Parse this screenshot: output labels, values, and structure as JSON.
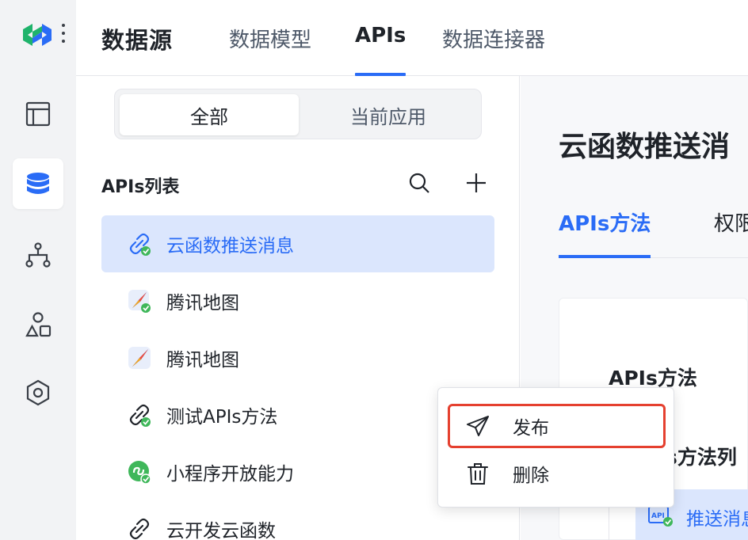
{
  "app": {
    "brand": "数据源",
    "tabs": [
      {
        "label": "数据模型"
      },
      {
        "label": "APIs"
      },
      {
        "label": "数据连接器"
      }
    ]
  },
  "rail": {
    "icons": [
      "layout-icon",
      "database-icon",
      "tree-structure-icon",
      "shapes-icon",
      "hexagon-settings-icon"
    ],
    "active": "database-icon"
  },
  "list": {
    "segments": [
      {
        "label": "全部"
      },
      {
        "label": "当前应用"
      }
    ],
    "title": "APIs列表",
    "items": [
      {
        "label": "云函数推送消息",
        "icon": "link-check-icon"
      },
      {
        "label": "腾讯地图",
        "icon": "compass-check-icon"
      },
      {
        "label": "腾讯地图",
        "icon": "compass-icon"
      },
      {
        "label": "测试APIs方法",
        "icon": "link-check-icon"
      },
      {
        "label": "小程序开放能力",
        "icon": "miniprogram-check-icon"
      },
      {
        "label": "云开发云函数",
        "icon": "link-icon"
      }
    ]
  },
  "detail": {
    "title": "云函数推送消",
    "tabs": [
      {
        "label": "APIs方法"
      },
      {
        "label": "权限"
      }
    ],
    "card_title": "APIs方法",
    "card_sub": "s方法列",
    "row_label": "推送消息"
  },
  "menu": {
    "items": [
      {
        "label": "发布"
      },
      {
        "label": "删除"
      }
    ]
  },
  "colors": {
    "accent": "#2a6cf6",
    "selected_bg": "#dbe6fd",
    "highlight_border": "#e5402f",
    "check_green": "#3fb75a"
  }
}
